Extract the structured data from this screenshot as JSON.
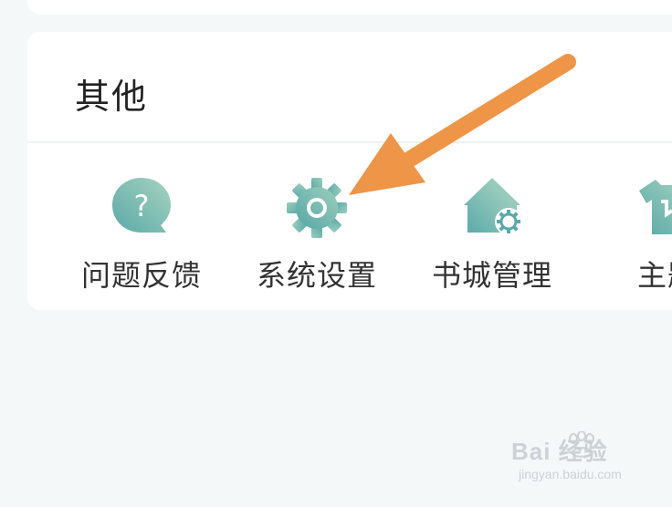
{
  "section": {
    "title": "其他"
  },
  "items": [
    {
      "label": "问题反馈",
      "icon": "feedback-question-icon"
    },
    {
      "label": "系统设置",
      "icon": "gear-icon"
    },
    {
      "label": "书城管理",
      "icon": "store-settings-icon"
    },
    {
      "label": "主题",
      "icon": "theme-shirt-icon"
    }
  ],
  "watermark": {
    "brand": "Bai 经验",
    "site": "jingyan.baidu.com"
  },
  "colors": {
    "icon_start": "#5fb3ad",
    "icon_end": "#a8d2c0",
    "arrow": "#ee9548",
    "background": "#f5f8f9"
  }
}
